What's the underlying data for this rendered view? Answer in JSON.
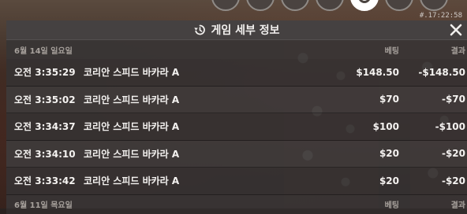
{
  "colors": {
    "panel_bg": "#3c3838",
    "text_primary": "#f4f2f0",
    "text_muted": "#a6a09b"
  },
  "top_bar": {
    "timestamp": "#.17:22:58"
  },
  "panel": {
    "title": "게임 세부 정보",
    "title_icon": "history-icon",
    "close_icon": "close-icon"
  },
  "groups": [
    {
      "date": "6월 14일 일요일",
      "bet_header": "베팅",
      "result_header": "결과",
      "rows": [
        {
          "time": "오전 3:35:29",
          "game": "코리안 스피드 바카라 A",
          "bet": "$148.50",
          "result": "-$148.50"
        },
        {
          "time": "오전 3:35:02",
          "game": "코리안 스피드 바카라 A",
          "bet": "$70",
          "result": "-$70"
        },
        {
          "time": "오전 3:34:37",
          "game": "코리안 스피드 바카라 A",
          "bet": "$100",
          "result": "-$100"
        },
        {
          "time": "오전 3:34:10",
          "game": "코리안 스피드 바카라 A",
          "bet": "$20",
          "result": "-$20"
        },
        {
          "time": "오전 3:33:42",
          "game": "코리안 스피드 바카라 A",
          "bet": "$20",
          "result": "-$20"
        }
      ]
    },
    {
      "date": "6월 11일 목요일",
      "bet_header": "베팅",
      "result_header": "결과"
    }
  ]
}
